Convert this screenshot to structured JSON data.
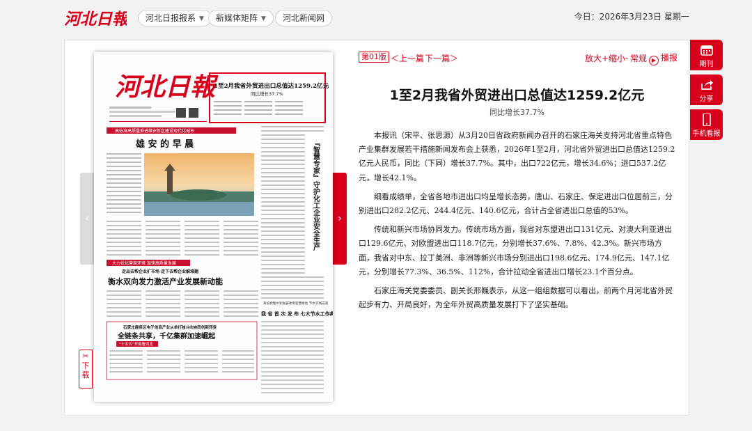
{
  "header": {
    "logo_text": "河北日報",
    "nav": [
      {
        "label": "河北日报报系",
        "has_caret": true
      },
      {
        "label": "新媒体矩阵",
        "has_caret": true
      },
      {
        "label": "河北新闻网",
        "has_caret": false
      }
    ],
    "date": "今日：2026年3月23日 星期一"
  },
  "toolbar": {
    "edition": "第01版",
    "prev": "＜上一篇",
    "next": "下一篇＞",
    "zoom_in": "放大+",
    "zoom_out": "缩小-",
    "zoom_normal": "常规",
    "play": "播报"
  },
  "side_tools": [
    {
      "label": "期刊",
      "icon": "calendar-icon"
    },
    {
      "label": "分享",
      "icon": "share-icon"
    },
    {
      "label": "手机看报",
      "icon": "phone-icon"
    }
  ],
  "download": "下载",
  "article": {
    "title": "1至2月我省外贸进出口总值达1259.2亿元",
    "subtitle": "同比增长37.7%",
    "paragraphs": [
      "本报讯（宋平、张思源）从3月20日省政府新闻办召开的石家庄海关支持河北省重点特色产业集群发展若干措施新闻发布会上获悉，2026年1至2月，河北省外贸进出口总值达1259.2亿元人民币，同比（下同）增长37.7%。其中，出口722亿元，增长34.6%；进口537.2亿元，增长42.1%。",
      "细看成绩单，全省各地市进出口均呈增长态势，唐山、石家庄、保定进出口位居前三，分别进出口282.2亿元、244.4亿元、140.6亿元，合计占全省进出口总值的53%。",
      "传统和新兴市场协同发力。传统市场方面，我省对东盟进出口131亿元、对澳大利亚进出口129.6亿元、对欧盟进出口118.7亿元，分别增长37.6%、7.8%、42.3%。新兴市场方面，我省对中东、拉丁美洲、非洲等新兴市场分别进出口198.6亿元、174.9亿元、147.1亿元，分别增长77.3%、36.5%、112%，合计拉动全省进出口增长23.1个百分点。",
      "石家庄海关党委委员、副关长邢巍表示，从这一组组数据可以看出，前两个月河北省外贸起步有力、开局良好，为全年外贸高质量发展打下了坚实基础。"
    ]
  },
  "paper": {
    "masthead": "河北日報",
    "highlight_title": "1至2月我省外贸进出口总值达1259.2亿元",
    "highlight_sub": "同比增长37.7%",
    "band1": "高标准高质量推进雄安新区建设现代化城市",
    "headline1": "雄 安 的 早 晨",
    "vertical_headline": "『智慧专家』守护化工企业安全生产",
    "band2": "大力优化营商环境  加快高质量发展",
    "sub_kicker": "走出去帮企业扩市场  走下去帮企业解难题",
    "headline2": "衡水双向发力激活产业发展新动能",
    "kicker3": "石家庄鹿泉区电子信息产业从单打独斗向协同创新转变",
    "headline3": "全链条共享，千亿集群加速崛起",
    "tag3": "“十五五”开局看河北",
    "right_kicker": "系统梳理水利发展政策智慧能动 节水实践成果",
    "right_headline": "我 省 首 次 发 布 七大节水工作典型案例集"
  }
}
